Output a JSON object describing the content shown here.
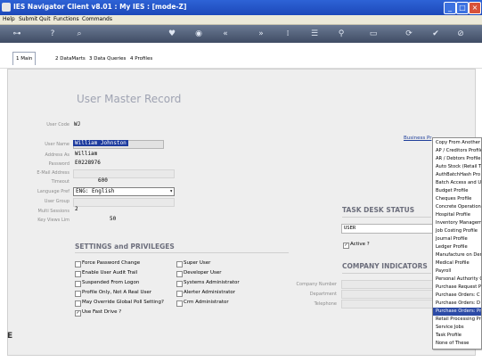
{
  "window": {
    "title": "IES Navigator Client  v8.01 : My IES :      [mode-Z]"
  },
  "menubar": [
    "Help",
    "Submit",
    "Quit",
    "Functions",
    "Commands"
  ],
  "toolbar_icons": [
    "key-icon",
    "help-icon",
    "search-icon",
    "heart-icon",
    "prev-icon",
    "first-icon",
    "last-icon",
    "next-icon",
    "list-icon",
    "filter-icon",
    "refresh-icon",
    "print-icon",
    "accept-icon",
    "cancel-icon"
  ],
  "tabs": [
    "1 Main",
    "2 DataMarts",
    "3 Data Queries",
    "4 Profiles"
  ],
  "heading": "User Master Record",
  "fields": {
    "user_code_label": "User Code",
    "user_code": "WJ",
    "user_name_label": "User Name",
    "user_name": "William Johnston",
    "address_as_label": "Address As",
    "address_as": "William",
    "password_label": "Password",
    "password": "E0228976",
    "email_label": "E-Mail Address",
    "timeout_label": "Timeout",
    "timeout": "600",
    "language_label": "Language Pref",
    "language": "ENG: English",
    "user_group_label": "User Group",
    "multi_sessions_label": "Multi Sessions",
    "multi_sessions": "2",
    "key_votes_label": "Key Views Lim",
    "key_votes": "50"
  },
  "settings": {
    "title": "SETTINGS and PRIVILEGES",
    "left": [
      {
        "label": "Force Password Change",
        "checked": false
      },
      {
        "label": "Enable User Audit Trail",
        "checked": false
      },
      {
        "label": "Suspended From Logon",
        "checked": false
      },
      {
        "label": "Profile Only, Not A Real User",
        "checked": false
      },
      {
        "label": "May Override Global Poll Setting?",
        "checked": false
      },
      {
        "label": "Use Fast Drive ?",
        "checked": true
      }
    ],
    "right": [
      {
        "label": "Super User",
        "checked": false
      },
      {
        "label": "Developer User",
        "checked": false
      },
      {
        "label": "Systems Administrator",
        "checked": false
      },
      {
        "label": "Alerter Administrator",
        "checked": false
      },
      {
        "label": "Crm Administrator",
        "checked": false
      }
    ]
  },
  "task_desk": {
    "title": "TASK DESK STATUS",
    "value": "USER",
    "active_label": "Active ?",
    "active": true
  },
  "company": {
    "title": "COMPANY INDICATORS",
    "company_number_label": "Company Number",
    "department_label": "Department",
    "telephone_label": "Telephone"
  },
  "business_link": "Business Pr",
  "context_menu": {
    "items": [
      "Copy From Another",
      "AP / Creditors Profile",
      "AR / Debtors Profile",
      "Auto Stock (Retail T",
      "AuthBatchHash Pro",
      "Batch Access and U",
      "Budget Profile",
      "Cheques Profile",
      "Concrete Operation",
      "Hospital Profile",
      "Inventory Managem",
      "Job Costing Profile",
      "Journal Profile",
      "Ledger Profile",
      "Manufacture on Den",
      "Medical Profile",
      "Payroll",
      "Personal Authority C",
      "Purchase Request P",
      "Purchase Orders: C",
      "Purchase Orders: D",
      "Purchase Orders: Pr",
      "Retail Processing Pro",
      "Service Jobs",
      "Task Profile",
      "None of These"
    ],
    "highlighted_index": 21
  },
  "colors": {
    "title_bar": "#1c48b9",
    "toolbar": "#4a5870",
    "highlight": "#2c4aa6"
  }
}
